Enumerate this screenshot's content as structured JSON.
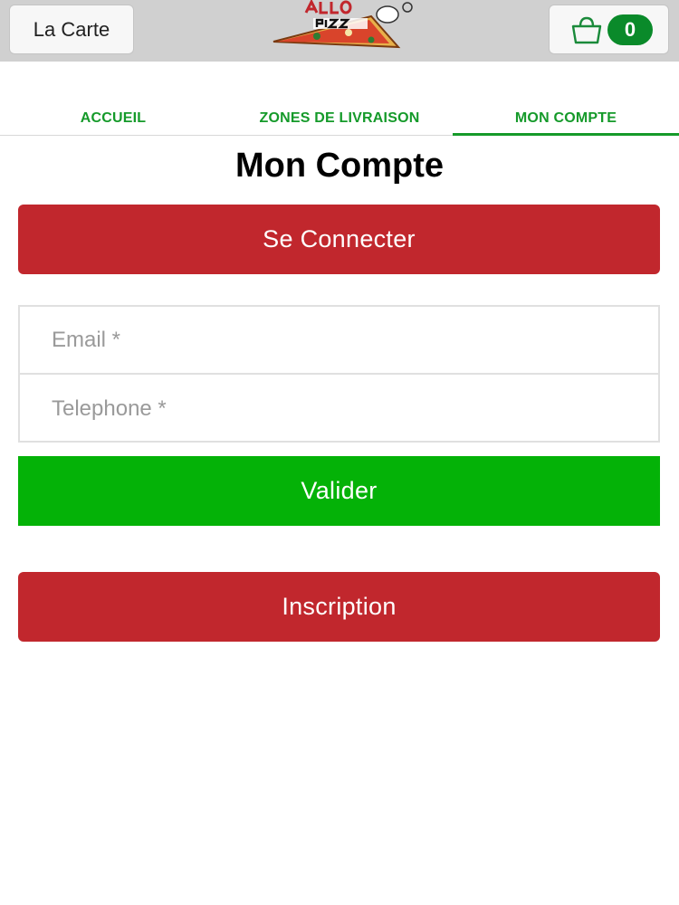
{
  "header": {
    "menu_label": "La Carte",
    "logo": "pizza-logo",
    "cart_icon": "shopping-bag-icon",
    "cart_count": "0"
  },
  "tabs": [
    {
      "label": "ACCUEIL"
    },
    {
      "label": "ZONES DE LIVRAISON"
    },
    {
      "label": "MON COMPTE",
      "active": true
    }
  ],
  "page": {
    "title": "Mon Compte"
  },
  "buttons": {
    "login": "Se Connecter",
    "validate": "Valider",
    "register": "Inscription"
  },
  "form": {
    "email_placeholder": "Email *",
    "phone_placeholder": "Telephone *",
    "email_value": "",
    "phone_value": ""
  },
  "colors": {
    "topbar": "#d0d0d0",
    "accent_green": "#159a2a",
    "red": "#c1272d",
    "validate_green": "#04b207",
    "badge_green": "#0a8a2a"
  }
}
